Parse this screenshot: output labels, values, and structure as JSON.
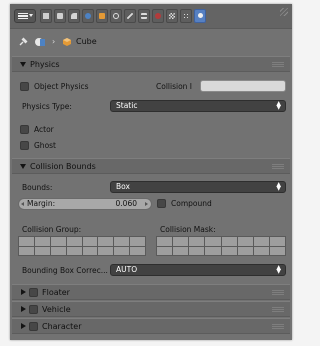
{
  "breadcrumb": {
    "sep": "›",
    "object": "Cube"
  },
  "physics": {
    "title": "Physics",
    "object_physics_label": "Object Physics",
    "collision_label": "Collision I",
    "collision_value": "",
    "physics_type_label": "Physics Type:",
    "physics_type_value": "Static",
    "actor_label": "Actor",
    "ghost_label": "Ghost"
  },
  "collision_bounds": {
    "title": "Collision Bounds",
    "bounds_label": "Bounds:",
    "bounds_value": "Box",
    "margin_label": "Margin:",
    "margin_value": "0.060",
    "compound_label": "Compound",
    "group_label": "Collision Group:",
    "mask_label": "Collision Mask:",
    "bbox_correction_label": "Bounding Box Correc...",
    "bbox_correction_value": "AUTO"
  },
  "collapsed_panels": {
    "floater": "Floater",
    "vehicle": "Vehicle",
    "character": "Character"
  },
  "colors": {
    "panel_bg": "#727272",
    "header_bg": "#646464",
    "dropdown_bg": "#424242",
    "active_tab": "#5680c2",
    "cube_icon": "#e49a36"
  },
  "header_icons": [
    "render-icon",
    "render-layers-icon",
    "scene-icon",
    "world-icon",
    "object-icon",
    "constraints-icon",
    "modifiers-icon",
    "data-icon",
    "material-icon",
    "texture-icon",
    "particles-icon",
    "physics-icon"
  ]
}
